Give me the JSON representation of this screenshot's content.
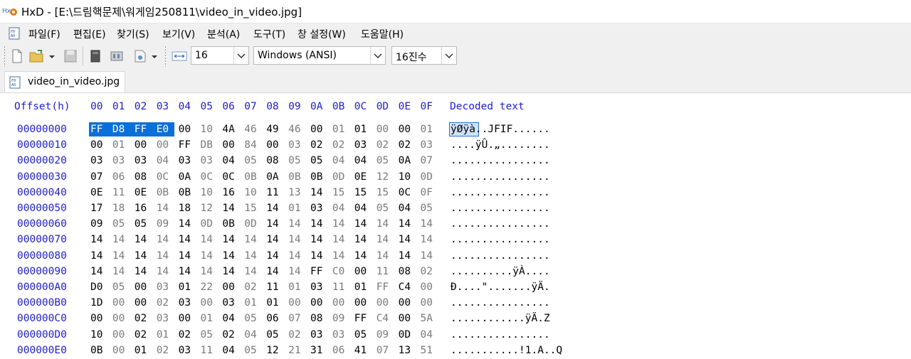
{
  "window": {
    "title": "HxD - [E:\\드림핵문제\\워게임250811\\video_in_video.jpg]"
  },
  "menubar": {
    "items": [
      "파일(F)",
      "편집(E)",
      "찾기(S)",
      "보기(V)",
      "분석(A)",
      "도구(T)",
      "창 설정(W)",
      "도움말(H)"
    ]
  },
  "toolbar": {
    "bytes_per_row": "16",
    "charset": "Windows (ANSI)",
    "offset_base": "16진수"
  },
  "tab": {
    "label": "video_in_video.jpg"
  },
  "hex": {
    "header_offset": "Offset(h)",
    "header_columns": [
      "00",
      "01",
      "02",
      "03",
      "04",
      "05",
      "06",
      "07",
      "08",
      "09",
      "0A",
      "0B",
      "0C",
      "0D",
      "0E",
      "0F"
    ],
    "header_decoded": "Decoded text",
    "selection": {
      "start": 0,
      "length": 4
    },
    "rows": [
      {
        "offset": "00000000",
        "bytes": [
          "FF",
          "D8",
          "FF",
          "E0",
          "00",
          "10",
          "4A",
          "46",
          "49",
          "46",
          "00",
          "01",
          "01",
          "00",
          "00",
          "01"
        ],
        "text": "ÿØÿà..JFIF......"
      },
      {
        "offset": "00000010",
        "bytes": [
          "00",
          "01",
          "00",
          "00",
          "FF",
          "DB",
          "00",
          "84",
          "00",
          "03",
          "02",
          "02",
          "03",
          "02",
          "02",
          "03"
        ],
        "text": "....ÿÛ.„........"
      },
      {
        "offset": "00000020",
        "bytes": [
          "03",
          "03",
          "03",
          "04",
          "03",
          "03",
          "04",
          "05",
          "08",
          "05",
          "05",
          "04",
          "04",
          "05",
          "0A",
          "07"
        ],
        "text": "................"
      },
      {
        "offset": "00000030",
        "bytes": [
          "07",
          "06",
          "08",
          "0C",
          "0A",
          "0C",
          "0C",
          "0B",
          "0A",
          "0B",
          "0B",
          "0D",
          "0E",
          "12",
          "10",
          "0D"
        ],
        "text": "................"
      },
      {
        "offset": "00000040",
        "bytes": [
          "0E",
          "11",
          "0E",
          "0B",
          "0B",
          "10",
          "16",
          "10",
          "11",
          "13",
          "14",
          "15",
          "15",
          "15",
          "0C",
          "0F"
        ],
        "text": "................"
      },
      {
        "offset": "00000050",
        "bytes": [
          "17",
          "18",
          "16",
          "14",
          "18",
          "12",
          "14",
          "15",
          "14",
          "01",
          "03",
          "04",
          "04",
          "05",
          "04",
          "05"
        ],
        "text": "................"
      },
      {
        "offset": "00000060",
        "bytes": [
          "09",
          "05",
          "05",
          "09",
          "14",
          "0D",
          "0B",
          "0D",
          "14",
          "14",
          "14",
          "14",
          "14",
          "14",
          "14",
          "14"
        ],
        "text": "................"
      },
      {
        "offset": "00000070",
        "bytes": [
          "14",
          "14",
          "14",
          "14",
          "14",
          "14",
          "14",
          "14",
          "14",
          "14",
          "14",
          "14",
          "14",
          "14",
          "14",
          "14"
        ],
        "text": "................"
      },
      {
        "offset": "00000080",
        "bytes": [
          "14",
          "14",
          "14",
          "14",
          "14",
          "14",
          "14",
          "14",
          "14",
          "14",
          "14",
          "14",
          "14",
          "14",
          "14",
          "14"
        ],
        "text": "................"
      },
      {
        "offset": "00000090",
        "bytes": [
          "14",
          "14",
          "14",
          "14",
          "14",
          "14",
          "14",
          "14",
          "14",
          "14",
          "FF",
          "C0",
          "00",
          "11",
          "08",
          "02"
        ],
        "text": "..........ÿÀ...."
      },
      {
        "offset": "000000A0",
        "bytes": [
          "D0",
          "05",
          "00",
          "03",
          "01",
          "22",
          "00",
          "02",
          "11",
          "01",
          "03",
          "11",
          "01",
          "FF",
          "C4",
          "00"
        ],
        "text": "Ð....\".......ÿÄ."
      },
      {
        "offset": "000000B0",
        "bytes": [
          "1D",
          "00",
          "00",
          "02",
          "03",
          "00",
          "03",
          "01",
          "01",
          "00",
          "00",
          "00",
          "00",
          "00",
          "00",
          "00"
        ],
        "text": "................"
      },
      {
        "offset": "000000C0",
        "bytes": [
          "00",
          "00",
          "02",
          "03",
          "00",
          "01",
          "04",
          "05",
          "06",
          "07",
          "08",
          "09",
          "FF",
          "C4",
          "00",
          "5A"
        ],
        "text": "............ÿÄ.Z"
      },
      {
        "offset": "000000D0",
        "bytes": [
          "10",
          "00",
          "02",
          "01",
          "02",
          "05",
          "02",
          "04",
          "05",
          "02",
          "03",
          "03",
          "05",
          "09",
          "0D",
          "04"
        ],
        "text": "................"
      },
      {
        "offset": "000000E0",
        "bytes": [
          "0B",
          "00",
          "01",
          "02",
          "03",
          "11",
          "04",
          "05",
          "12",
          "21",
          "31",
          "06",
          "41",
          "07",
          "13",
          "51"
        ],
        "text": "...........!1.A..Q"
      }
    ]
  }
}
